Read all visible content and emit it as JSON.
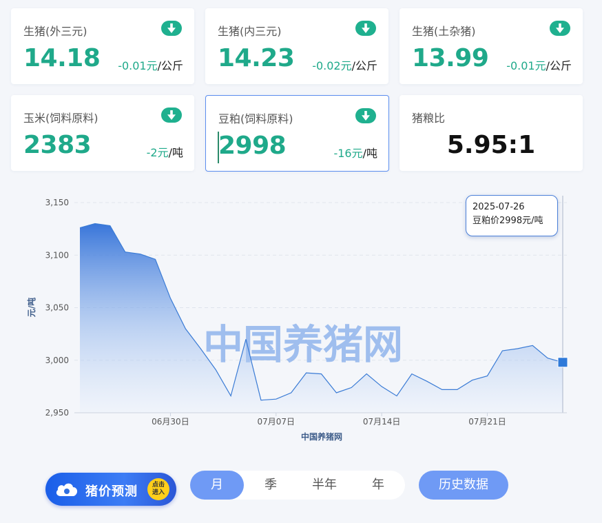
{
  "cards": [
    {
      "name": "生猪(外三元)",
      "value": "14.18",
      "change": "-0.01元",
      "unit": "/公斤"
    },
    {
      "name": "生猪(内三元)",
      "value": "14.23",
      "change": "-0.02元",
      "unit": "/公斤"
    },
    {
      "name": "生猪(土杂猪)",
      "value": "13.99",
      "change": "-0.01元",
      "unit": "/公斤"
    },
    {
      "name": "玉米(饲料原料)",
      "value": "2383",
      "change": "-2元",
      "unit": "/吨"
    },
    {
      "name": "豆粕(饲料原料)",
      "value": "2998",
      "change": "-16元",
      "unit": "/吨"
    },
    {
      "name": "猪粮比",
      "value": "5.95:1"
    }
  ],
  "tooltip": {
    "date": "2025-07-26",
    "text": "豆粕价2998元/吨"
  },
  "watermark": "中国养猪网",
  "colors": {
    "accent": "#1fa98a",
    "line": "#3a7bd5",
    "button": "#6f9af5"
  },
  "predict": {
    "label": "猪价预测",
    "badge_line1": "点击",
    "badge_line2": "进入",
    "icon": "cloud-icon"
  },
  "periods": [
    {
      "label": "月",
      "active": true
    },
    {
      "label": "季"
    },
    {
      "label": "半年"
    },
    {
      "label": "年"
    }
  ],
  "history_button": "历史数据",
  "chart_data": {
    "type": "area",
    "title": "",
    "xlabel": "中国养猪网",
    "ylabel": "元/吨",
    "ylim": [
      2950,
      3150
    ],
    "yticks": [
      "2,950",
      "3,000",
      "3,050",
      "3,100",
      "3,150"
    ],
    "xticks": [
      "06月30日",
      "07月07日",
      "07月14日",
      "07月21日"
    ],
    "grid": true,
    "series": [
      {
        "x": [
          "2025-06-24",
          "2025-06-25",
          "2025-06-26",
          "2025-06-27",
          "2025-06-28",
          "2025-06-29",
          "2025-06-30",
          "2025-07-01",
          "2025-07-02",
          "2025-07-03",
          "2025-07-04",
          "2025-07-05",
          "2025-07-06",
          "2025-07-07",
          "2025-07-08",
          "2025-07-09",
          "2025-07-10",
          "2025-07-11",
          "2025-07-12",
          "2025-07-13",
          "2025-07-14",
          "2025-07-15",
          "2025-07-16",
          "2025-07-17",
          "2025-07-18",
          "2025-07-19",
          "2025-07-20",
          "2025-07-21",
          "2025-07-22",
          "2025-07-23",
          "2025-07-24",
          "2025-07-25",
          "2025-07-26"
        ],
        "values": [
          3126,
          3130,
          3128,
          3103,
          3101,
          3096,
          3059,
          3030,
          3011,
          2991,
          2966,
          3020,
          2962,
          2963,
          2969,
          2988,
          2987,
          2969,
          2974,
          2987,
          2975,
          2966,
          2987,
          2980,
          2972,
          2972,
          2981,
          2985,
          3009,
          3011,
          3014,
          3002,
          2998
        ]
      }
    ]
  }
}
